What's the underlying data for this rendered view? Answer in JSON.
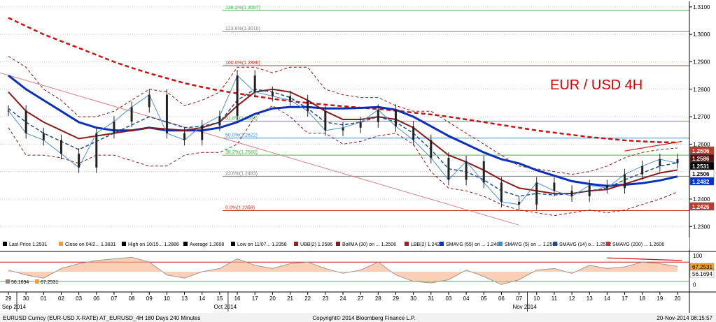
{
  "chart_data": {
    "type": "line",
    "title": "EUR / USD 4H",
    "y_ticks": [
      "1.3100",
      "1.3000",
      "1.2900",
      "1.2800",
      "1.2700",
      "1.2600",
      "1.2500",
      "1.2400",
      "1.2300"
    ],
    "ylim": [
      1.226,
      1.312
    ],
    "fib_levels": [
      {
        "label": "138.2%(1.3087)",
        "value": 1.3087,
        "color": "#4caf50"
      },
      {
        "label": "123.6%(1.3010)",
        "value": 1.301,
        "color": "#808080"
      },
      {
        "label": "100.0%(1.2886)",
        "value": 1.2886,
        "color": "#c0392b"
      },
      {
        "label": "61.8%(1.2684)",
        "value": 1.2684,
        "color": "#4caf50"
      },
      {
        "label": "50.0%(1.2622)",
        "value": 1.2622,
        "color": "#3b8ed0"
      },
      {
        "label": "38.2%(1.2560)",
        "value": 1.256,
        "color": "#4caf50"
      },
      {
        "label": "23.6%(1.2483)",
        "value": 1.2483,
        "color": "#808080"
      },
      {
        "label": "0.0%(1.2358)",
        "value": 1.2358,
        "color": "#c0392b"
      }
    ],
    "price_badges": [
      {
        "label": "1.2606",
        "value": 1.2606,
        "bg": "#c0392b",
        "fg": "#ffffff"
      },
      {
        "label": "1.2586",
        "value": 1.2586,
        "bg": "#5a1010",
        "fg": "#ffffff"
      },
      {
        "label": "1.2531",
        "value": 1.2531,
        "bg": "#000000",
        "fg": "#ffffff"
      },
      {
        "label": "1.2506",
        "value": 1.2506,
        "bg": "#ffffff",
        "fg": "#000000"
      },
      {
        "label": "1.2482",
        "value": 1.2482,
        "bg": "#0033cc",
        "fg": "#ffffff"
      },
      {
        "label": "1.2426",
        "value": 1.2426,
        "bg": "#c0392b",
        "fg": "#ffffff"
      }
    ],
    "legend": [
      {
        "label": "Last Price 1.2531",
        "color": "#000000"
      },
      {
        "label": "Close on 04/2... 1.3831",
        "color": "#f0a030"
      },
      {
        "label": "High on 10/15... 1.2886",
        "color": "#000000"
      },
      {
        "label": "Average 1.2608",
        "color": "#000000"
      },
      {
        "label": "Low on 11/07... 1.2358",
        "color": "#000000"
      },
      {
        "label": "UBB(2) 1.2586",
        "color": "#a02020"
      },
      {
        "label": "BollMA (30) on ... 1.2506",
        "color": "#8b1a1a"
      },
      {
        "label": "LBB(2) 1.2426",
        "color": "#a02020"
      },
      {
        "label": "SMAVG (55) on ... 1.2482",
        "color": "#0033cc"
      },
      {
        "label": "SMAVG (5) on ... 1.2544",
        "color": "#3b8ed0"
      },
      {
        "label": "SMAVG (14) o... 1.2532",
        "color": "#1f4e8c"
      },
      {
        "label": "SMAVG (200) ... 1.2606",
        "color": "#c0392b"
      }
    ],
    "oscillator": {
      "ticks": [
        "100",
        "0"
      ],
      "labels": [
        "56.1694",
        "67.2531"
      ],
      "right_labels": [
        "67.2531",
        "56.1694"
      ]
    },
    "x_days": [
      "29",
      "30",
      "01",
      "02",
      "03",
      "06",
      "07",
      "08",
      "09",
      "10",
      "13",
      "14",
      "15",
      "16",
      "17",
      "20",
      "21",
      "22",
      "23",
      "24",
      "27",
      "28",
      "29",
      "30",
      "31",
      "03",
      "04",
      "05",
      "06",
      "07",
      "10",
      "11",
      "12",
      "13",
      "14",
      "17",
      "18",
      "19",
      "20"
    ],
    "month_labels": [
      {
        "label": "Sep 2014",
        "after_index": 0
      },
      {
        "label": "Oct 2014",
        "after_index": 12
      },
      {
        "label": "Nov 2014",
        "after_index": 29
      }
    ],
    "series": {
      "price": [
        1.2722,
        1.264,
        1.2615,
        1.2565,
        1.2515,
        1.264,
        1.2682,
        1.2735,
        1.278,
        1.264,
        1.2615,
        1.2668,
        1.2702,
        1.285,
        1.279,
        1.2775,
        1.276,
        1.272,
        1.265,
        1.266,
        1.268,
        1.2725,
        1.2665,
        1.2615,
        1.255,
        1.247,
        1.2538,
        1.246,
        1.239,
        1.238,
        1.246,
        1.243,
        1.241,
        1.245,
        1.244,
        1.249,
        1.252,
        1.2545,
        1.2531
      ],
      "bollma": [
        1.279,
        1.272,
        1.268,
        1.265,
        1.262,
        1.263,
        1.264,
        1.265,
        1.266,
        1.2655,
        1.265,
        1.266,
        1.268,
        1.274,
        1.279,
        1.28,
        1.279,
        1.276,
        1.272,
        1.269,
        1.269,
        1.27,
        1.269,
        1.266,
        1.261,
        1.256,
        1.2535,
        1.2505,
        1.247,
        1.244,
        1.243,
        1.242,
        1.242,
        1.243,
        1.2435,
        1.2455,
        1.2475,
        1.2495,
        1.2506
      ],
      "sma55": [
        1.285,
        1.28,
        1.276,
        1.272,
        1.268,
        1.266,
        1.265,
        1.265,
        1.266,
        1.265,
        1.265,
        1.265,
        1.266,
        1.268,
        1.271,
        1.273,
        1.2735,
        1.2735,
        1.273,
        1.273,
        1.2732,
        1.2735,
        1.2725,
        1.27,
        1.2665,
        1.263,
        1.26,
        1.257,
        1.2545,
        1.253,
        1.2505,
        1.2485,
        1.2465,
        1.2455,
        1.2448,
        1.2452,
        1.2458,
        1.2468,
        1.2482
      ],
      "sma14": [
        1.273,
        1.268,
        1.264,
        1.261,
        1.258,
        1.261,
        1.264,
        1.267,
        1.27,
        1.268,
        1.266,
        1.2665,
        1.268,
        1.276,
        1.28,
        1.279,
        1.277,
        1.273,
        1.268,
        1.267,
        1.268,
        1.27,
        1.268,
        1.264,
        1.258,
        1.251,
        1.25,
        1.247,
        1.243,
        1.241,
        1.242,
        1.2415,
        1.242,
        1.243,
        1.244,
        1.247,
        1.2495,
        1.252,
        1.2532
      ],
      "sma200": [
        1.306,
        1.303,
        1.3,
        1.2975,
        1.295,
        1.2925,
        1.29,
        1.2878,
        1.2858,
        1.284,
        1.2822,
        1.2808,
        1.2795,
        1.2785,
        1.2775,
        1.2765,
        1.2757,
        1.275,
        1.2744,
        1.2738,
        1.2733,
        1.2728,
        1.2722,
        1.2715,
        1.2708,
        1.27,
        1.269,
        1.268,
        1.267,
        1.266,
        1.265,
        1.2642,
        1.2634,
        1.2626,
        1.262,
        1.2614,
        1.261,
        1.2607,
        1.2606
      ],
      "ubb": [
        1.292,
        1.288,
        1.28,
        1.276,
        1.27,
        1.27,
        1.272,
        1.276,
        1.28,
        1.279,
        1.274,
        1.276,
        1.279,
        1.288,
        1.288,
        1.286,
        1.288,
        1.288,
        1.28,
        1.278,
        1.277,
        1.277,
        1.274,
        1.272,
        1.272,
        1.268,
        1.264,
        1.26,
        1.256,
        1.252,
        1.251,
        1.25,
        1.249,
        1.25,
        1.252,
        1.255,
        1.257,
        1.258,
        1.2586
      ],
      "lbb": [
        1.266,
        1.256,
        1.256,
        1.255,
        1.253,
        1.256,
        1.256,
        1.254,
        1.252,
        1.252,
        1.256,
        1.257,
        1.257,
        1.26,
        1.27,
        1.274,
        1.27,
        1.264,
        1.264,
        1.26,
        1.261,
        1.263,
        1.264,
        1.26,
        1.25,
        1.244,
        1.243,
        1.241,
        1.238,
        1.236,
        1.235,
        1.234,
        1.235,
        1.236,
        1.235,
        1.236,
        1.238,
        1.24,
        1.2426
      ],
      "osc": [
        55,
        40,
        30,
        60,
        75,
        85,
        90,
        95,
        80,
        40,
        30,
        50,
        60,
        90,
        70,
        60,
        75,
        80,
        60,
        45,
        55,
        80,
        40,
        20,
        15,
        25,
        55,
        35,
        10,
        25,
        55,
        60,
        45,
        70,
        60,
        65,
        80,
        75,
        67
      ]
    }
  },
  "footer": {
    "left": "EURUSD Curncy (EUR-USD X-RATE) AT_EURUSD_4H 180 Days 240 Minutes",
    "center": "Copyright© 2014 Bloomberg Finance L.P.",
    "right": "20-Nov-2014 08:15:57"
  }
}
